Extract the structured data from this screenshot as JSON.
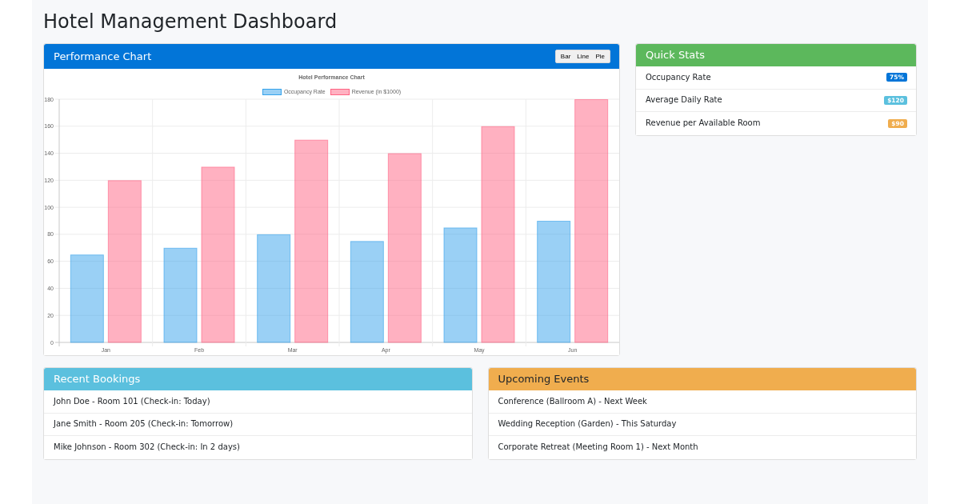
{
  "page": {
    "title": "Hotel Management Dashboard"
  },
  "performance": {
    "title": "Performance Chart",
    "chart_buttons": [
      "Bar",
      "Line",
      "Pie"
    ],
    "chart_data": [
      {
        "type": "bar",
        "title": "Hotel Performance Chart",
        "categories": [
          "Jan",
          "Feb",
          "Mar",
          "Apr",
          "May",
          "Jun"
        ],
        "series": [
          {
            "name": "Occupancy Rate",
            "color": "#36a2eb",
            "values": [
              65,
              70,
              80,
              75,
              85,
              90
            ]
          },
          {
            "name": "Revenue (in $1000)",
            "color": "#ff6384",
            "values": [
              120,
              130,
              150,
              140,
              160,
              180
            ]
          }
        ],
        "ylim": [
          0,
          180
        ],
        "yticks": [
          0,
          20,
          40,
          60,
          80,
          100,
          120,
          140,
          160,
          180
        ],
        "grid": true,
        "legend": "top"
      }
    ]
  },
  "quick_stats": {
    "title": "Quick Stats",
    "items": [
      {
        "label": "Occupancy Rate",
        "value": "75%",
        "color": "#0275d8"
      },
      {
        "label": "Average Daily Rate",
        "value": "$120",
        "color": "#5bc0de"
      },
      {
        "label": "Revenue per Available Room",
        "value": "$90",
        "color": "#f0ad4e"
      }
    ]
  },
  "recent_bookings": {
    "title": "Recent Bookings",
    "items": [
      "John Doe - Room 101 (Check-in: Today)",
      "Jane Smith - Room 205 (Check-in: Tomorrow)",
      "Mike Johnson - Room 302 (Check-in: In 2 days)"
    ]
  },
  "upcoming_events": {
    "title": "Upcoming Events",
    "items": [
      "Conference (Ballroom A) - Next Week",
      "Wedding Reception (Garden) - This Saturday",
      "Corporate Retreat (Meeting Room 1) - Next Month"
    ]
  }
}
